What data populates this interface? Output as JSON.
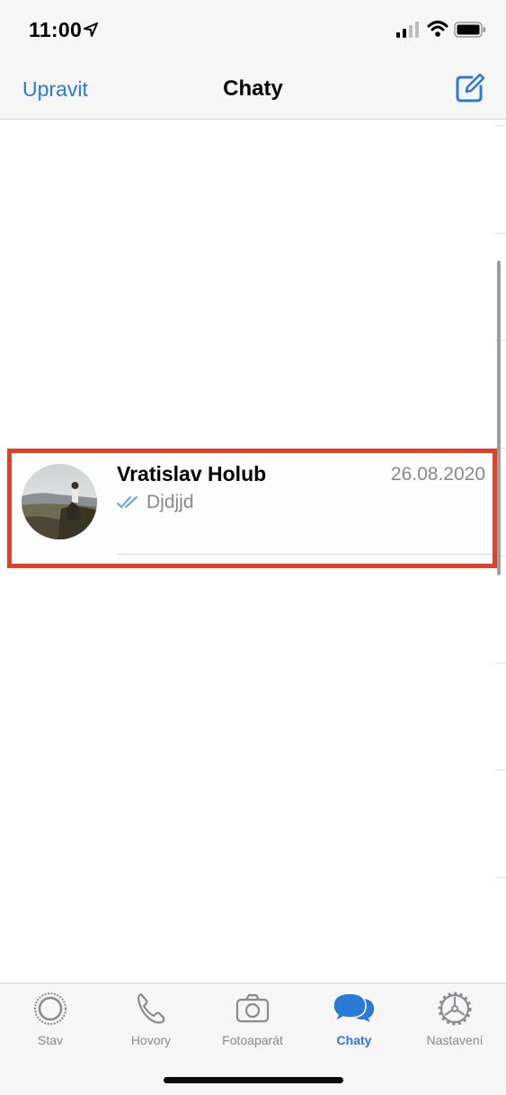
{
  "status_bar": {
    "time": "11:00",
    "icons": [
      "location-arrow-icon",
      "cellular-signal-icon",
      "wifi-icon",
      "battery-icon"
    ]
  },
  "nav": {
    "edit_label": "Upravit",
    "title": "Chaty",
    "compose_icon": "compose-icon"
  },
  "chats": [
    {
      "name": "Vratislav Holub",
      "date": "26.08.2020",
      "preview": "Djdjjd",
      "status_icon": "double-check-icon",
      "avatar": "avatar-photo"
    }
  ],
  "tabs": [
    {
      "label": "Stav",
      "icon": "status-icon",
      "active": false
    },
    {
      "label": "Hovory",
      "icon": "phone-icon",
      "active": false
    },
    {
      "label": "Fotoaparát",
      "icon": "camera-icon",
      "active": false
    },
    {
      "label": "Chaty",
      "icon": "chats-icon",
      "active": true
    },
    {
      "label": "Nastavení",
      "icon": "gear-icon",
      "active": false
    }
  ],
  "colors": {
    "accent": "#2a7ad6",
    "secondary_text": "#8a8a8e",
    "highlight": "#e2402a",
    "bar_background": "#f6f6f6"
  }
}
